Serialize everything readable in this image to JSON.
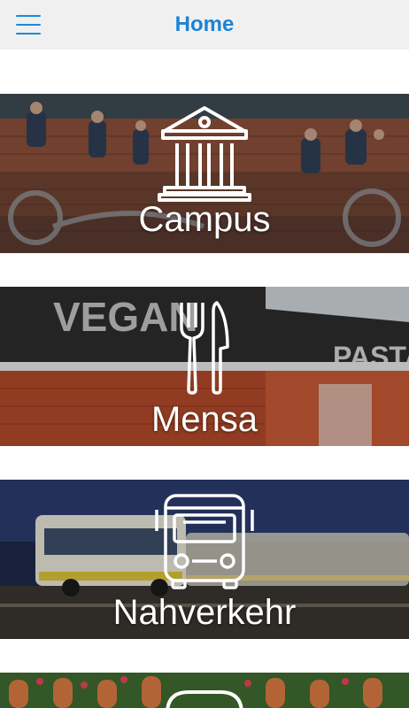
{
  "header": {
    "title": "Home",
    "menu_icon": "hamburger-menu-icon"
  },
  "tiles": [
    {
      "label": "Campus",
      "icon": "building-columns-icon"
    },
    {
      "label": "Mensa",
      "icon": "fork-knife-icon"
    },
    {
      "label": "Nahverkehr",
      "icon": "bus-icon"
    },
    {
      "label": "",
      "icon": "partial-icon"
    }
  ],
  "colors": {
    "accent": "#1a84d6",
    "header_bg": "#f0f0f0",
    "tile_text": "#ffffff"
  }
}
